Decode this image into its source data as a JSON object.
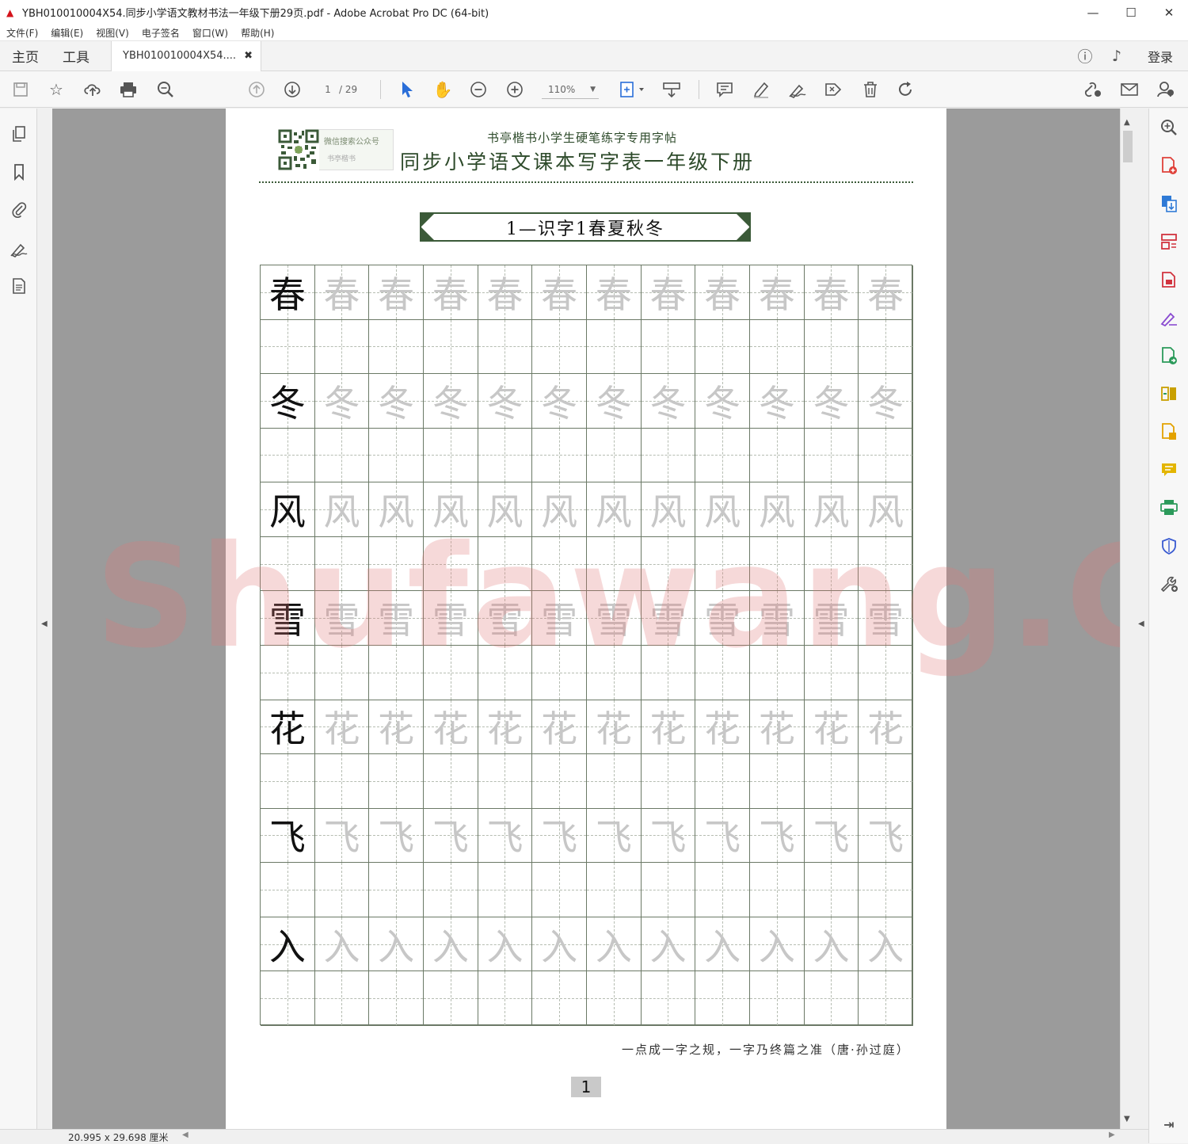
{
  "window": {
    "title": "YBH010010004X54.同步小学语文教材书法一年级下册29页.pdf - Adobe Acrobat Pro DC (64-bit)",
    "minimize": "—",
    "maximize": "☐",
    "close": "✕"
  },
  "menu": [
    "文件(F)",
    "编辑(E)",
    "视图(V)",
    "电子签名",
    "窗口(W)",
    "帮助(H)"
  ],
  "tabs": {
    "home": "主页",
    "tools": "工具",
    "document": "YBH010010004X54....",
    "document_close": "✖",
    "login": "登录"
  },
  "toolbar": {
    "page_current": "1",
    "page_total": "/ 29",
    "zoom": "110%"
  },
  "document": {
    "qr_label_1": "微信搜索公众号",
    "qr_label_2": "书亭楷书",
    "subtitle": "书亭楷书小学生硬笔练字专用字帖",
    "title": "同步小学语文课本写字表一年级下册",
    "lesson": "1—识字1春夏秋冬",
    "characters": [
      "春",
      "冬",
      "风",
      "雪",
      "花",
      "飞",
      "入"
    ],
    "quote": "一点成一字之规，一字乃终篇之准（唐·孙过庭）",
    "page_number": "1"
  },
  "watermark": "Shufawang.CN",
  "status": {
    "dimensions": "20.995 x 29.698 厘米"
  }
}
